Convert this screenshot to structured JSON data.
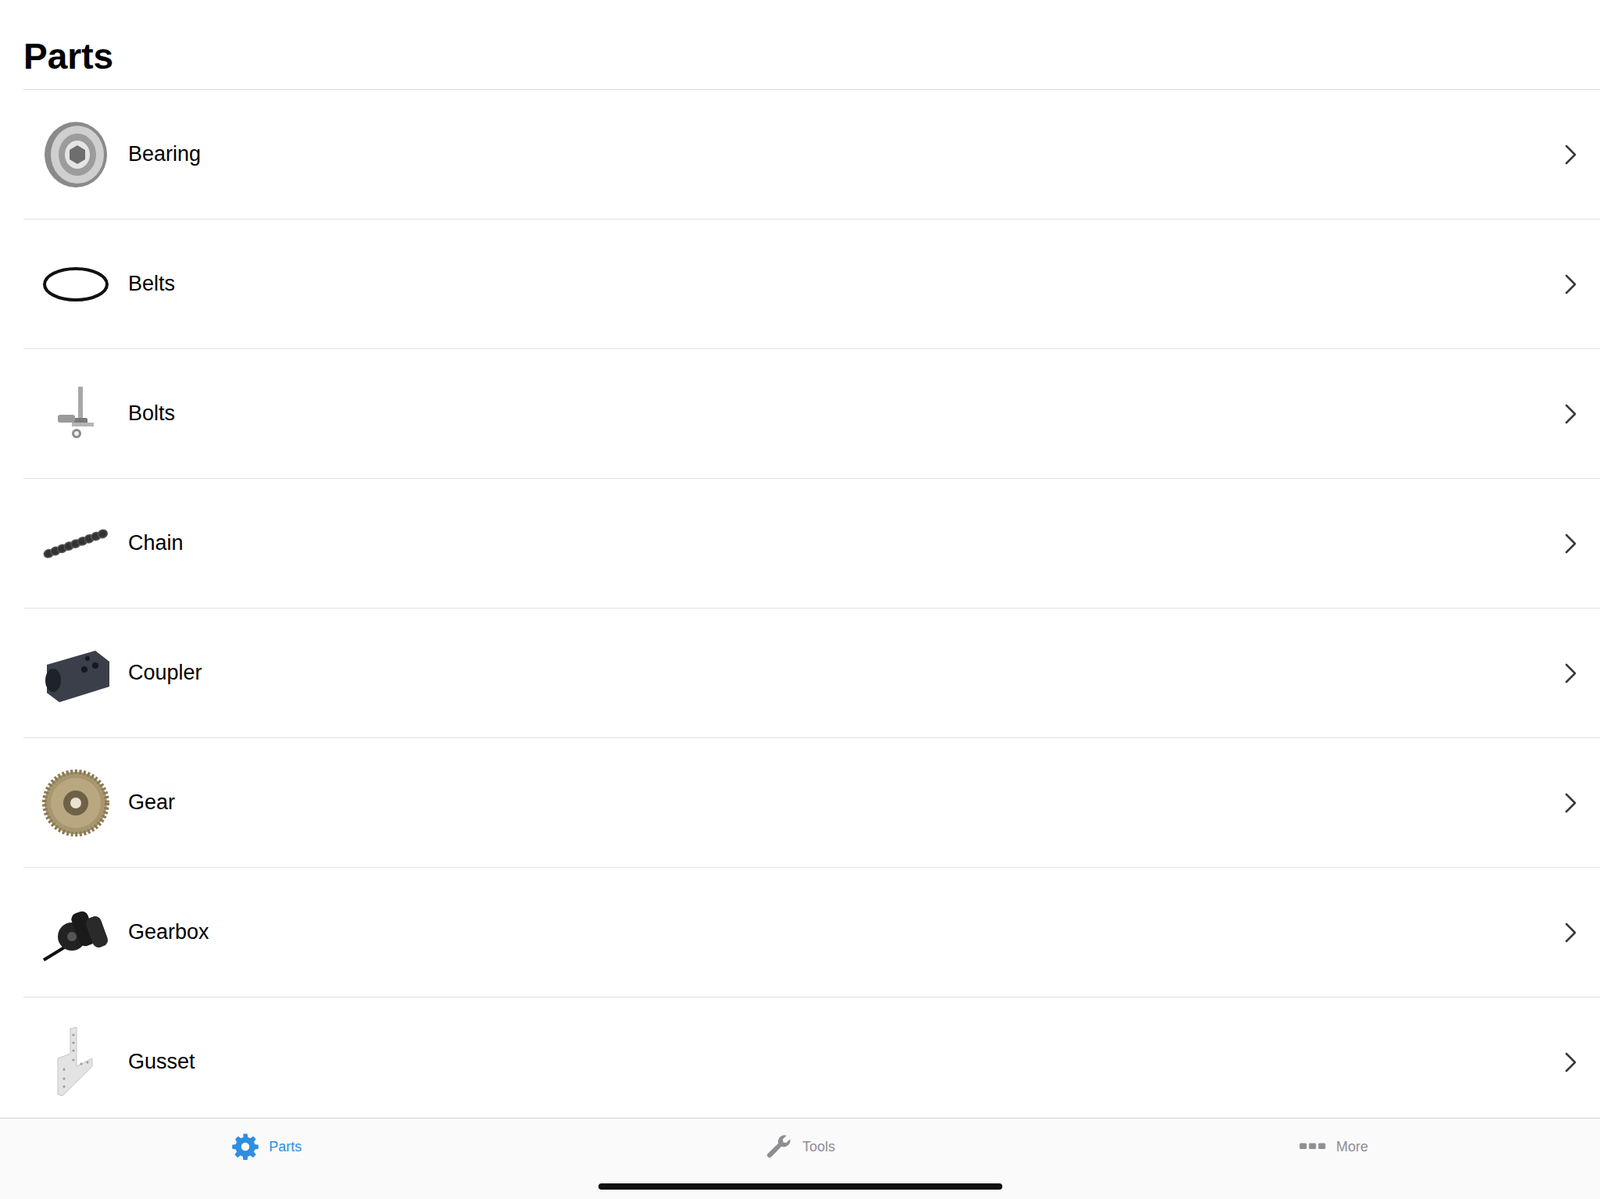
{
  "header": {
    "title": "Parts"
  },
  "items": [
    {
      "label": "Bearing"
    },
    {
      "label": "Belts"
    },
    {
      "label": "Bolts"
    },
    {
      "label": "Chain"
    },
    {
      "label": "Coupler"
    },
    {
      "label": "Gear"
    },
    {
      "label": "Gearbox"
    },
    {
      "label": "Gusset"
    }
  ],
  "tabs": [
    {
      "label": "Parts",
      "selected": true
    },
    {
      "label": "Tools",
      "selected": false
    },
    {
      "label": "More",
      "selected": false
    }
  ]
}
